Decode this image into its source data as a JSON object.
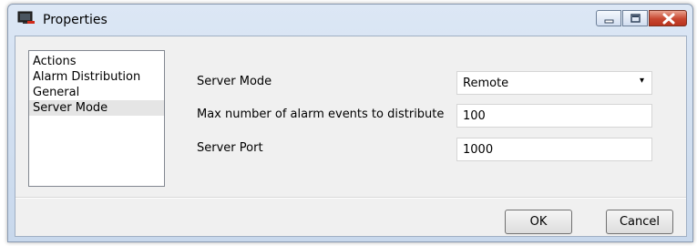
{
  "window": {
    "title": "Properties"
  },
  "nav": {
    "items": [
      {
        "label": "Actions"
      },
      {
        "label": "Alarm Distribution"
      },
      {
        "label": "General"
      },
      {
        "label": "Server Mode",
        "selected": true
      }
    ]
  },
  "form": {
    "server_mode": {
      "label": "Server Mode",
      "value": "Remote"
    },
    "max_events": {
      "label": "Max number of alarm events to distribute",
      "value": "100"
    },
    "server_port": {
      "label": "Server Port",
      "value": "1000"
    }
  },
  "buttons": {
    "ok": "OK",
    "cancel": "Cancel"
  },
  "colors": {
    "close_button": "#c8462f",
    "selection": "#e5e5e5"
  }
}
